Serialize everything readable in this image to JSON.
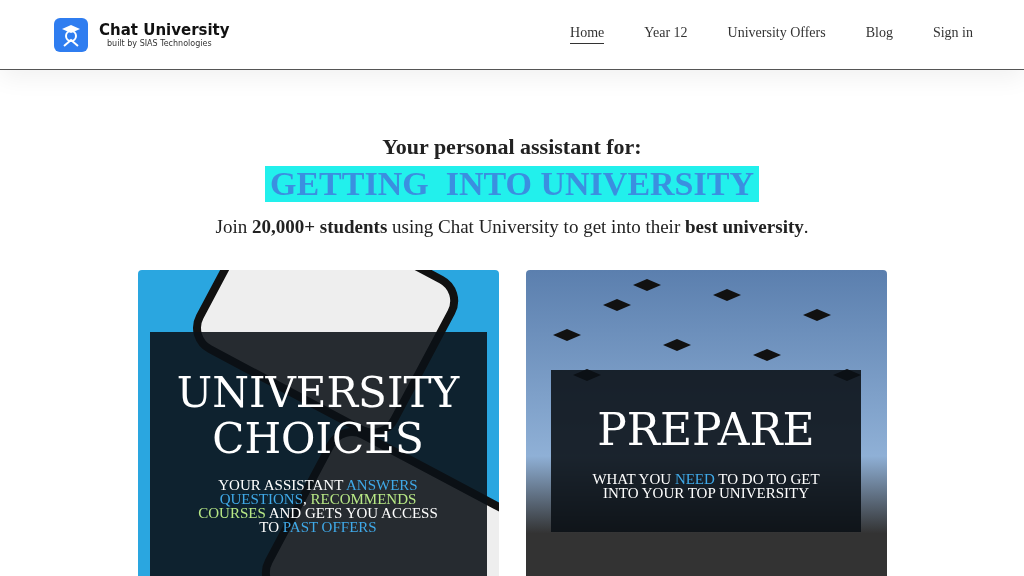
{
  "brand": {
    "name": "Chat University",
    "tagline": "built by SIAS Technologies"
  },
  "nav": [
    {
      "label": "Home",
      "selected": true
    },
    {
      "label": "Year 12",
      "selected": false
    },
    {
      "label": "University Offers",
      "selected": false
    },
    {
      "label": "Blog",
      "selected": false
    },
    {
      "label": "Sign in",
      "selected": false
    }
  ],
  "hero": {
    "kicker": "Your personal assistant for:",
    "highlight": "GETTING  INTO UNIVERSITY",
    "subtitle": "Join **20,000+ students** using Chat University to get into their **best university**."
  },
  "cards": [
    {
      "kind": "phones",
      "title_lines": [
        "UNIVERSITY",
        "CHOICES"
      ],
      "caption": [
        {
          "text": "YOUR ASSISTANT "
        },
        {
          "text": "ANSWERS QUESTIONS",
          "color": "#3fa9e8"
        },
        {
          "text": ", "
        },
        {
          "text": "RECOMMENDS COURSES",
          "color": "#b8e986"
        },
        {
          "text": " AND GETS YOU ACCESS TO "
        },
        {
          "text": "PAST OFFERS",
          "color": "#3fa9e8"
        }
      ]
    },
    {
      "kind": "graduation",
      "title_lines": [
        "PREPARE"
      ],
      "caption": [
        {
          "text": "WHAT YOU "
        },
        {
          "text": "NEED",
          "color": "#3fa9e8"
        },
        {
          "text": " TO DO TO GET INTO YOUR TOP UNIVERSITY"
        }
      ]
    }
  ]
}
